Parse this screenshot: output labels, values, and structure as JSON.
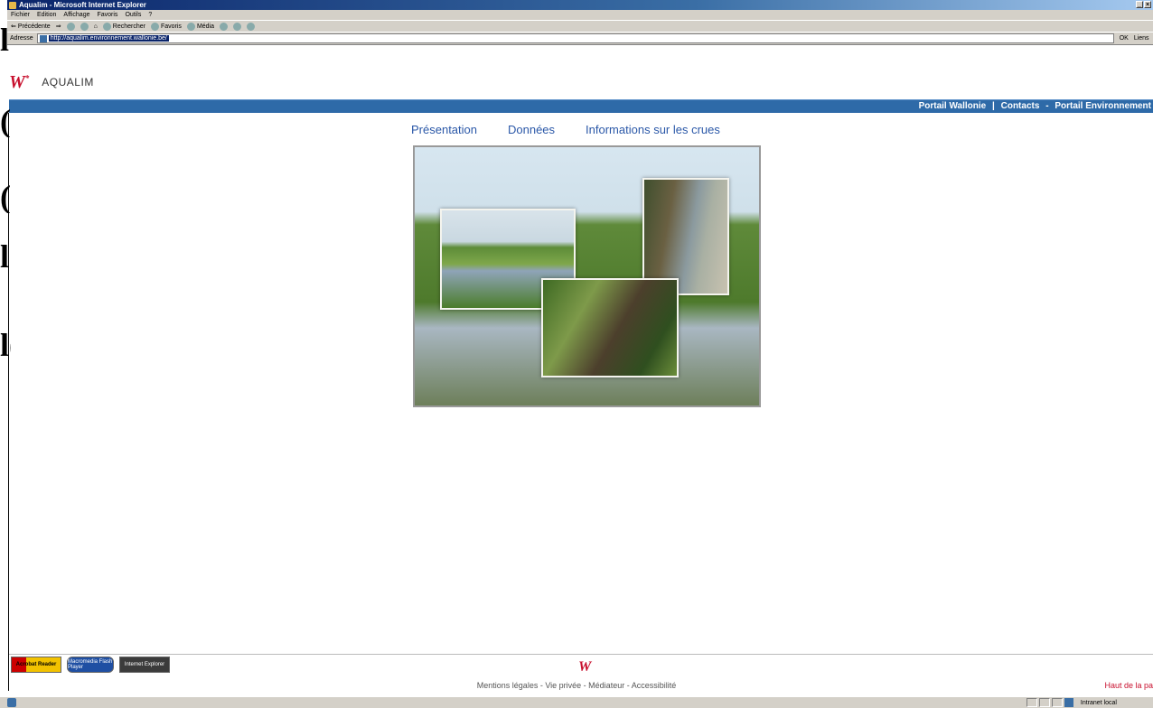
{
  "window": {
    "title": "Aqualim - Microsoft Internet Explorer",
    "controls": [
      "_",
      "×"
    ]
  },
  "menu": [
    "Fichier",
    "Edition",
    "Affichage",
    "Favoris",
    "Outils",
    "?"
  ],
  "toolbar": {
    "back": "Précédente",
    "search": "Rechercher",
    "favorites": "Favoris",
    "media": "Média"
  },
  "address": {
    "label": "Adresse",
    "url": "http://aqualim.environnement.wallonie.be/",
    "go": "OK",
    "links": "Liens"
  },
  "site": {
    "logo": "W",
    "name": "AQUALIM"
  },
  "toplinks": {
    "a": "Portail Wallonie",
    "sep1": "|",
    "b": "Contacts",
    "sep2": "-",
    "c": "Portail Environnement"
  },
  "nav": [
    "Présentation",
    "Données",
    "Informations sur les crues"
  ],
  "bg_glyphs": [
    "l",
    "(",
    "(",
    "l",
    "l("
  ],
  "footer": {
    "badges": [
      "Acrobat Reader",
      "Macromedia Flash Player",
      "Internet Explorer"
    ],
    "logo": "W",
    "links": "Mentions légales - Vie privée - Médiateur - Accessibilité",
    "top": "Haut de la pa"
  },
  "status": {
    "zone": "Intranet local"
  }
}
